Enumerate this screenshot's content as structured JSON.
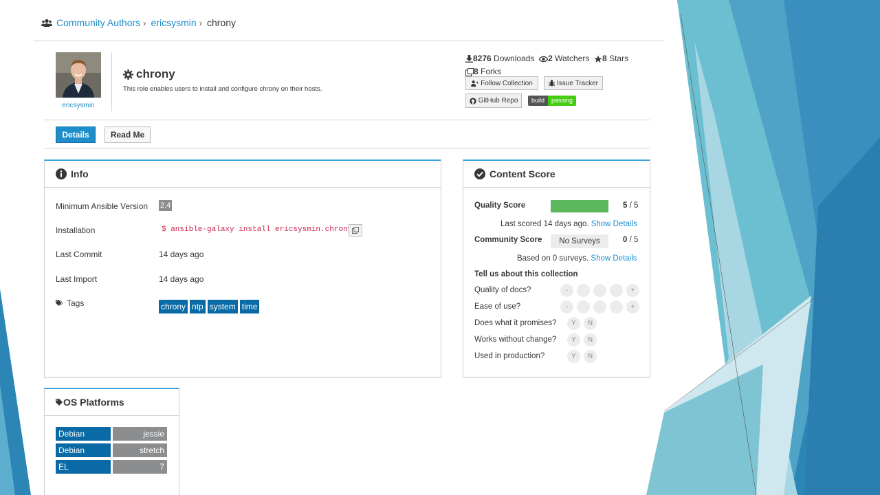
{
  "breadcrumb": {
    "authors": "Community Authors",
    "sep": "›",
    "owner": "ericsysmin",
    "current": "chrony"
  },
  "header": {
    "owner": "ericsysmin",
    "title": "chrony",
    "description": "This role enables users to install and configure chrony on their hosts."
  },
  "stats": {
    "downloads_count": "8276",
    "downloads_label": "Downloads",
    "watchers_count": "2",
    "watchers_label": "Watchers",
    "stars_count": "8",
    "stars_label": "Stars",
    "forks_count": "8",
    "forks_label": "Forks"
  },
  "actions": {
    "follow": "Follow Collection",
    "issue": "Issue Tracker",
    "github": "GitHub Repo",
    "badge_left": "build",
    "badge_right": "passing"
  },
  "tabs": {
    "details": "Details",
    "readme": "Read Me"
  },
  "info": {
    "title": "Info",
    "min_ansible_label": "Minimum Ansible Version",
    "min_ansible_value": "2.4",
    "installation_label": "Installation",
    "installation_value": "$ ansible-galaxy install ericsysmin.chrony",
    "last_commit_label": "Last Commit",
    "last_commit_value": "14 days ago",
    "last_import_label": "Last Import",
    "last_import_value": "14 days ago",
    "tags_label": "Tags",
    "tags": [
      "chrony",
      "ntp",
      "system",
      "time"
    ]
  },
  "score": {
    "title": "Content Score",
    "quality_label": "Quality Score",
    "quality_value": "5",
    "quality_max": "/ 5",
    "quality_fraction": 1.0,
    "last_scored": "Last scored 14 days ago.",
    "show_details": "Show Details",
    "community_label": "Community Score",
    "no_surveys": "No Surveys",
    "community_value": "0",
    "community_max": "/ 5",
    "based_on": "Based on 0 surveys.",
    "show_details2": "Show Details",
    "survey_title": "Tell us about this collection",
    "q1": "Quality of docs?",
    "q2": "Ease of use?",
    "q3": "Does what it promises?",
    "q4": "Works without change?",
    "q5": "Used in production?",
    "minus": "-",
    "plus": "+",
    "yes": "Y",
    "no": "N"
  },
  "os": {
    "title": "OS Platforms",
    "platforms": [
      {
        "name": "Debian",
        "version": "jessie"
      },
      {
        "name": "Debian",
        "version": "stretch"
      },
      {
        "name": "EL",
        "version": "7"
      }
    ]
  },
  "colors": {
    "accent": "#39a5dc",
    "link": "#1f8dc9",
    "tag": "#0a6aa6",
    "score_bar": "#5cb85c",
    "badge_pass": "#44cc11"
  }
}
